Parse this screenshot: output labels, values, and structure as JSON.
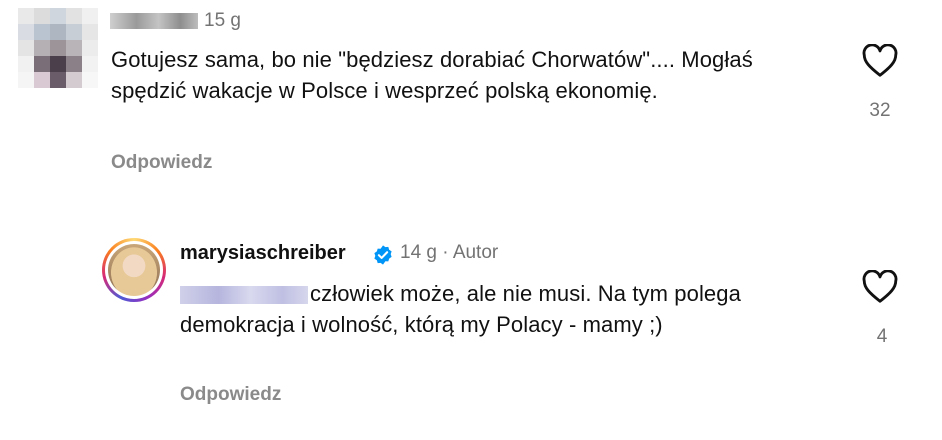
{
  "comment1": {
    "time": "15 g",
    "text": "Gotujesz sama, bo nie \"będziesz dorabiać Chorwatów\".... Mogłaś spędzić wakacje w Polsce i wesprzeć polską ekonomię.",
    "reply_label": "Odpowiedz",
    "like_count": "32",
    "like_icon": "heart-icon"
  },
  "comment2": {
    "username": "marysiaschreiber",
    "verified_icon": "verified-badge-icon",
    "meta": "14 g · Autor",
    "text": "człowiek może, ale nie musi. Na tym polega demokracja i wolność, którą my Polacy - mamy ;)",
    "reply_label": "Odpowiedz",
    "like_count": "4",
    "like_icon": "heart-icon"
  },
  "colors": {
    "secondary_text": "#737373",
    "verified_blue": "#0095f6",
    "text": "#111111"
  }
}
